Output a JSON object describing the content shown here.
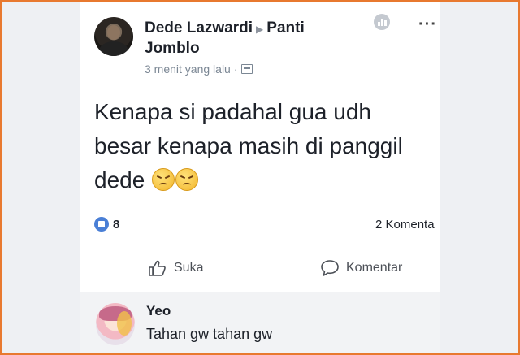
{
  "post": {
    "author": "Dede Lazwardi",
    "group": "Panti Jomblo",
    "timestamp": "3 menit yang lalu",
    "audience_icon": "group-audience-icon",
    "text": "Kenapa si padahal gua udh\nbesar kenapa masih di panggil\ndede",
    "emojis": [
      "angry-face-emoji",
      "angry-face-emoji"
    ],
    "like_count": "8",
    "comment_count": "2 Komenta"
  },
  "actions": {
    "like_label": "Suka",
    "comment_label": "Komentar"
  },
  "comment": {
    "name": "Yeo",
    "text": "Tahan gw tahan gw"
  },
  "colors": {
    "frame_border": "#e8792f",
    "like_blue": "#4a7fd6"
  }
}
